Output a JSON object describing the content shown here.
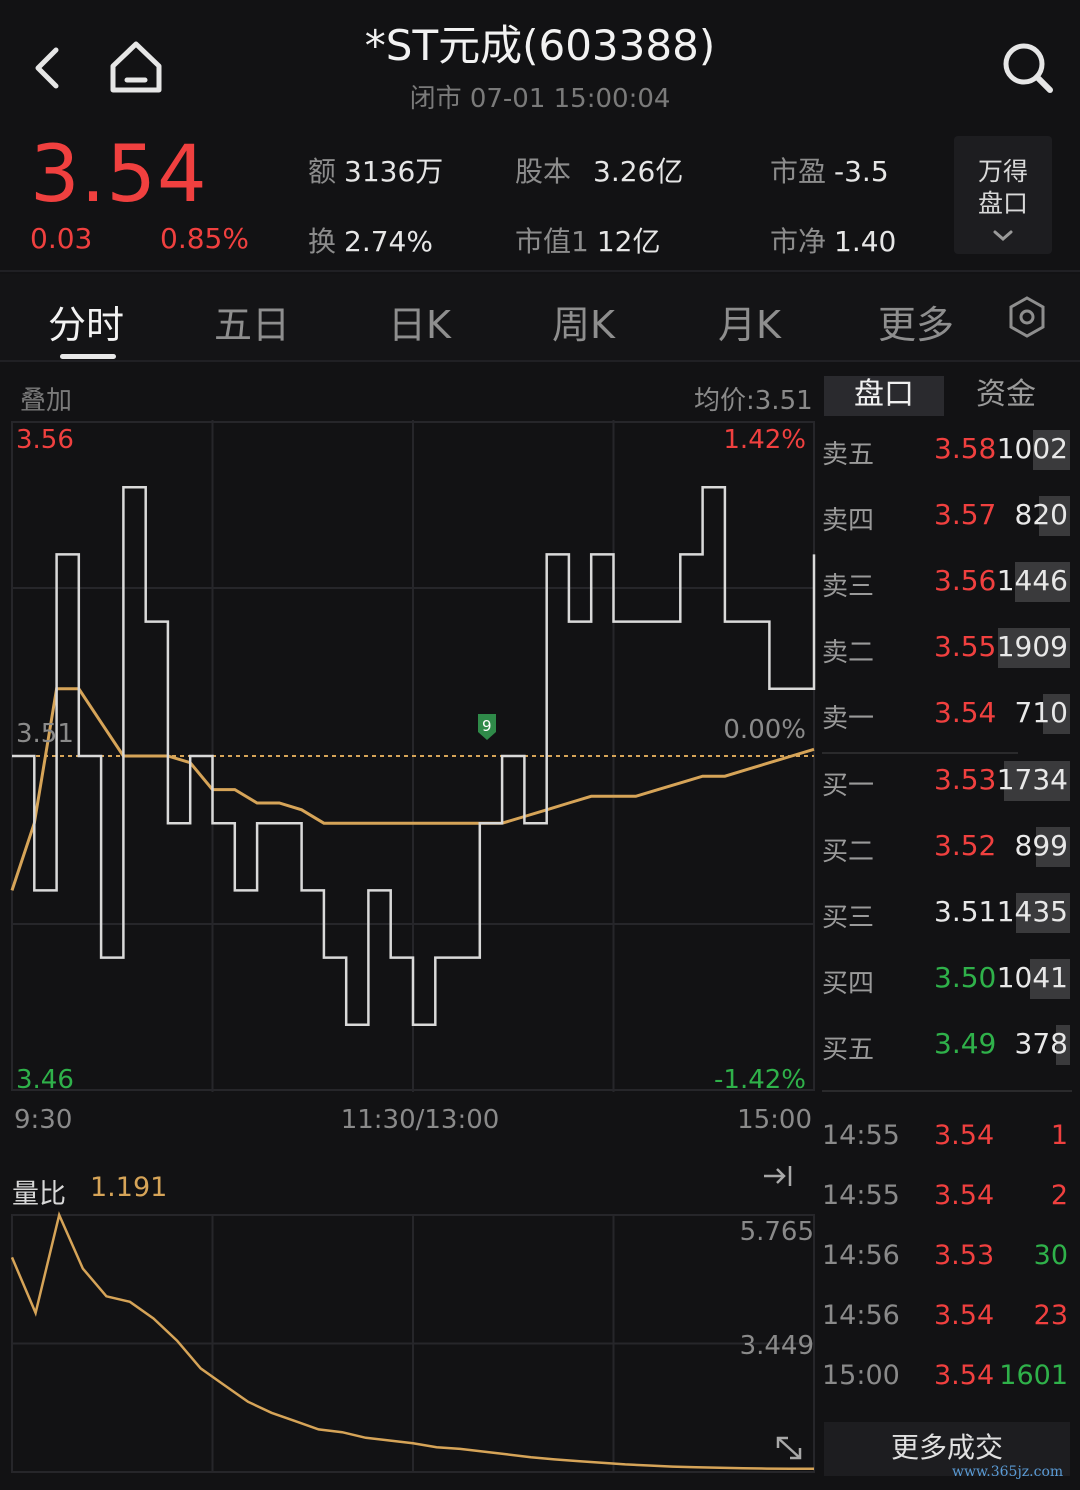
{
  "header": {
    "title": "*ST元成(603388)",
    "status": "闭市 07-01 15:00:04"
  },
  "quote": {
    "price": "3.54",
    "change": "0.03",
    "change_pct": "0.85%",
    "stats": [
      {
        "label": "额",
        "value": "3136万"
      },
      {
        "label": "股本",
        "value": "3.26亿"
      },
      {
        "label": "市盈",
        "value": "-3.5"
      },
      {
        "label": "换",
        "value": "2.74%"
      },
      {
        "label": "市值1",
        "value": "12亿"
      },
      {
        "label": "市净",
        "value": "1.40"
      }
    ],
    "wande_line1": "万得",
    "wande_line2": "盘口"
  },
  "tabs": [
    "分时",
    "五日",
    "日K",
    "周K",
    "月K",
    "更多"
  ],
  "chart": {
    "overlay_label": "叠加",
    "avg_label": "均价:3.51",
    "y_max_label": "3.56",
    "y_mid_label": "3.51",
    "y_min_label": "3.46",
    "pct_max_label": "1.42%",
    "pct_mid_label": "0.00%",
    "pct_min_label": "-1.42%",
    "x_labels": [
      "9:30",
      "11:30/13:00",
      "15:00"
    ],
    "marker_label": "9",
    "volratio_label": "量比",
    "volratio_value": "1.191",
    "vol_max_label": "5.765",
    "vol_mid_label": "3.449",
    "colors": {
      "price": "#d9d9d9",
      "avg": "#d6a458",
      "prev_close": "#d6a458",
      "up": "#f0403f",
      "down": "#2fb14a"
    }
  },
  "chart_data": {
    "type": "line",
    "ylim": [
      3.46,
      3.56
    ],
    "prev_close": 3.51,
    "x_ticks": [
      "9:30",
      "11:30/13:00",
      "15:00"
    ],
    "series": [
      {
        "values": [
          3.51,
          3.49,
          3.54,
          3.51,
          3.48,
          3.55,
          3.53,
          3.5,
          3.51,
          3.5,
          3.49,
          3.5,
          3.5,
          3.49,
          3.48,
          3.47,
          3.49,
          3.48,
          3.47,
          3.48,
          3.48,
          3.5,
          3.51,
          3.5,
          3.54,
          3.53,
          3.54,
          3.53,
          3.53,
          3.53,
          3.54,
          3.55,
          3.53,
          3.53,
          3.52,
          3.52,
          3.54
        ]
      },
      {
        "values": [
          3.49,
          3.5,
          3.52,
          3.52,
          3.515,
          3.51,
          3.51,
          3.51,
          3.509,
          3.505,
          3.505,
          3.503,
          3.503,
          3.502,
          3.5,
          3.5,
          3.5,
          3.5,
          3.5,
          3.5,
          3.5,
          3.5,
          3.5,
          3.501,
          3.502,
          3.503,
          3.504,
          3.504,
          3.504,
          3.505,
          3.506,
          3.507,
          3.507,
          3.508,
          3.509,
          3.51,
          3.511
        ]
      }
    ],
    "volume_ratio": {
      "ylim": [
        1.133,
        5.765
      ],
      "values": [
        5.0,
        4.0,
        5.765,
        4.8,
        4.3,
        4.2,
        3.9,
        3.5,
        3.0,
        2.7,
        2.4,
        2.2,
        2.05,
        1.9,
        1.85,
        1.75,
        1.7,
        1.65,
        1.58,
        1.55,
        1.5,
        1.45,
        1.4,
        1.36,
        1.33,
        1.3,
        1.27,
        1.25,
        1.23,
        1.22,
        1.21,
        1.2,
        1.195,
        1.193,
        1.191
      ]
    }
  },
  "order_book": {
    "tabs": [
      "盘口",
      "资金"
    ],
    "asks": [
      {
        "name": "卖五",
        "price": "3.58",
        "vol": "1002",
        "bar": 0.52
      },
      {
        "name": "卖四",
        "price": "3.57",
        "vol": "820",
        "bar": 0.43
      },
      {
        "name": "卖三",
        "price": "3.56",
        "vol": "1446",
        "bar": 0.76
      },
      {
        "name": "卖二",
        "price": "3.55",
        "vol": "1909",
        "bar": 1.0
      },
      {
        "name": "卖一",
        "price": "3.54",
        "vol": "710",
        "bar": 0.37
      }
    ],
    "bids": [
      {
        "name": "买一",
        "price": "3.53",
        "vol": "1734",
        "bar": 0.91
      },
      {
        "name": "买二",
        "price": "3.52",
        "vol": "899",
        "bar": 0.47
      },
      {
        "name": "买三",
        "price": "3.51",
        "vol": "1435",
        "bar": 0.75
      },
      {
        "name": "买四",
        "price": "3.50",
        "vol": "1041",
        "bar": 0.55
      },
      {
        "name": "买五",
        "price": "3.49",
        "vol": "378",
        "bar": 0.2
      }
    ]
  },
  "trades": [
    {
      "time": "14:55",
      "price": "3.54",
      "vol": "1",
      "pc": "red",
      "vc": "red"
    },
    {
      "time": "14:55",
      "price": "3.54",
      "vol": "2",
      "pc": "red",
      "vc": "red"
    },
    {
      "time": "14:56",
      "price": "3.53",
      "vol": "30",
      "pc": "red",
      "vc": "green"
    },
    {
      "time": "14:56",
      "price": "3.54",
      "vol": "23",
      "pc": "red",
      "vc": "red"
    },
    {
      "time": "15:00",
      "price": "3.54",
      "vol": "1601",
      "pc": "red",
      "vc": "green"
    }
  ],
  "more_trades_label": "更多成交",
  "watermark": "www.365jz.com"
}
